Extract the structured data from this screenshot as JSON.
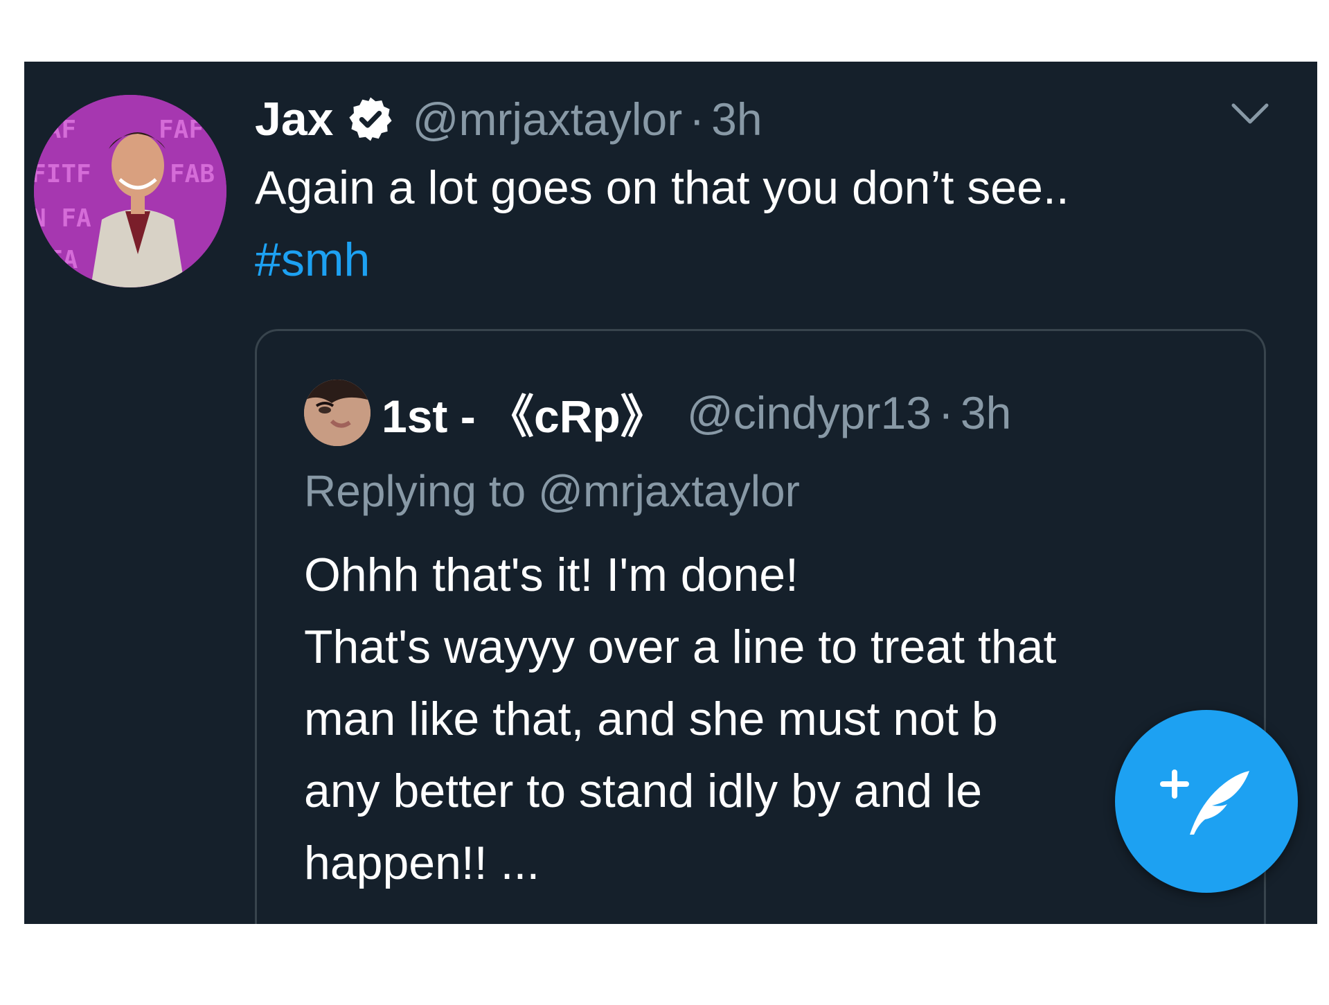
{
  "tweet": {
    "author_name": "Jax",
    "author_handle": "@mrjaxtaylor",
    "separator": "·",
    "time": "3h",
    "text": "Again a lot goes on that you don’t see..",
    "hashtag": "#smh",
    "verified": true,
    "avatar_sign_text": "FAF FITF FAB N FA"
  },
  "quoted_tweet": {
    "author_name": "1st - 《cRp》",
    "author_handle": "@cindypr13",
    "separator": "·",
    "time": "3h",
    "replying_to": "Replying to @mrjaxtaylor",
    "text_lines": [
      "Ohhh that's it! I'm done!",
      "That's wayyy over a line to treat that",
      "man like that, and she must not b",
      "any better to stand idly by and le",
      "happen!! ..."
    ]
  },
  "icons": {
    "verified": "verified-badge-icon",
    "menu": "chevron-down-icon",
    "compose": "compose-tweet-icon"
  },
  "colors": {
    "background": "#15202b",
    "text": "#ffffff",
    "secondary_text": "#8899a6",
    "accent": "#1da1f2",
    "border": "#38444d"
  }
}
